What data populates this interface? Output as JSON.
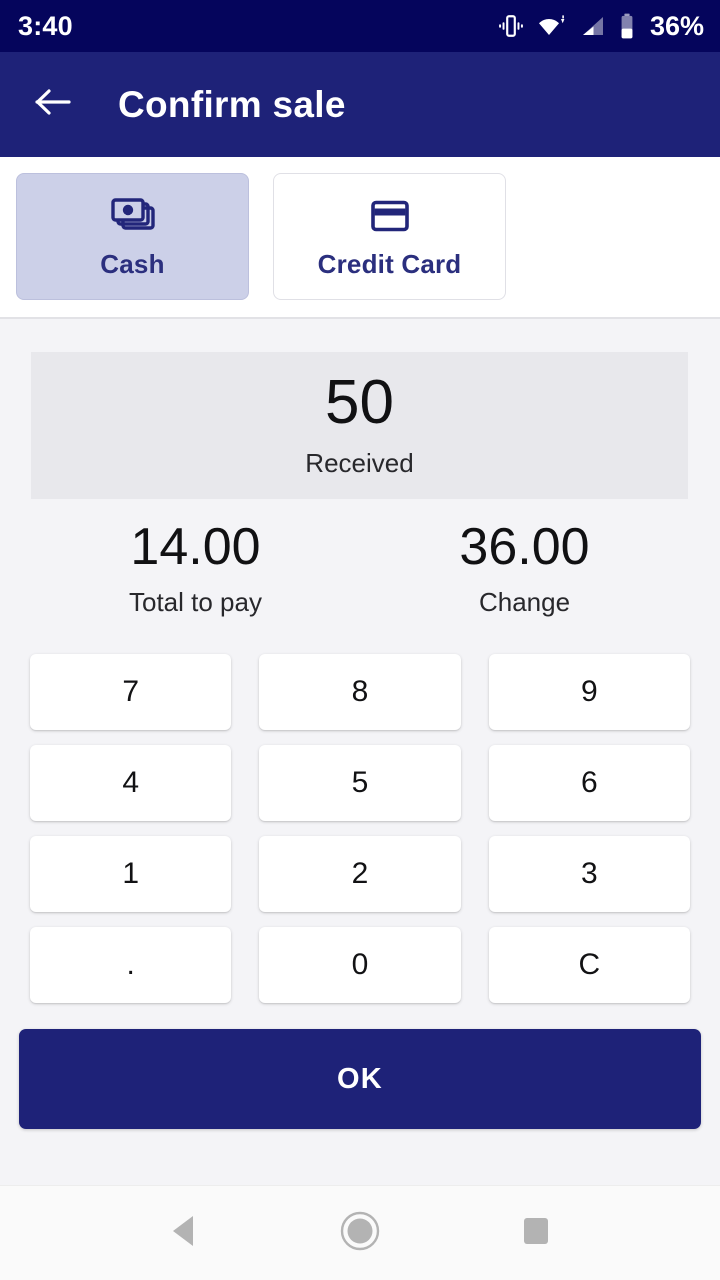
{
  "statusbar": {
    "time": "3:40",
    "battery_percent": "36%",
    "icons": [
      "vibrate-icon",
      "wifi-icon",
      "cellular-signal-icon",
      "battery-icon"
    ]
  },
  "appbar": {
    "back_icon": "arrow-left-icon",
    "title": "Confirm sale",
    "background": "#1e2278"
  },
  "payment_methods": {
    "selected": "Cash",
    "options": [
      {
        "label": "Cash",
        "icon": "banknotes-icon",
        "selected": true
      },
      {
        "label": "Credit Card",
        "icon": "credit-card-icon",
        "selected": false
      }
    ],
    "selected_background": "#ccd0e8",
    "accent": "#2b2f7e"
  },
  "received": {
    "value": "50",
    "label": "Received"
  },
  "totals": [
    {
      "value": "14.00",
      "label": "Total to pay"
    },
    {
      "value": "36.00",
      "label": "Change"
    }
  ],
  "keypad": {
    "keys": [
      "7",
      "8",
      "9",
      "4",
      "5",
      "6",
      "1",
      "2",
      "3",
      ".",
      "0",
      "C"
    ]
  },
  "confirm": {
    "label": "OK",
    "background": "#1e2278"
  },
  "navbar": {
    "buttons": [
      "back-triangle-icon",
      "home-circle-icon",
      "recents-square-icon"
    ]
  }
}
